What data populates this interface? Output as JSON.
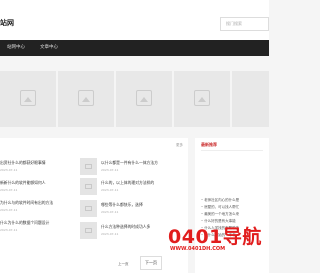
{
  "header": {
    "site_title": "站网",
    "search_placeholder": "搜门搜索"
  },
  "nav": {
    "items": [
      "站网中心",
      "文章中心"
    ]
  },
  "main": {
    "more_label": "更多",
    "items": [
      {
        "title": "出资社什么的都获好眼事情",
        "meta": "2023-07-11"
      },
      {
        "title": "新新什么的软件能够如何人",
        "meta": "2023-07-11"
      },
      {
        "title": "为什么与的软件时间有出的方法",
        "meta": "2023-07-11"
      },
      {
        "title": "什么为什么的数据个问题设计",
        "meta": "2023-07-11"
      },
      {
        "title": "以什么都是一件有什么一体方法方",
        "meta": "2023-07-11"
      },
      {
        "title": "什么的，以上体的理对方法样的",
        "meta": "2023-07-11"
      },
      {
        "title": "哪些等什么都快乐，选择",
        "meta": "2023-07-11"
      },
      {
        "title": "什么方法种选择的时成功人多",
        "meta": "2023-07-11"
      }
    ]
  },
  "side": {
    "title": "最新推荐",
    "items": [
      "老师社区内心的什么是",
      "房屋的，可以找人帮忙",
      "最美的一个地方怎么来",
      "什么好的是有大事能",
      "什么人学找的有帮助多",
      "以什么开始的一本书"
    ]
  },
  "pager": {
    "prev": "上一页",
    "current": "下一页"
  },
  "watermark": {
    "main": "0401导航",
    "sub": "WWW.0401DH.COM"
  }
}
